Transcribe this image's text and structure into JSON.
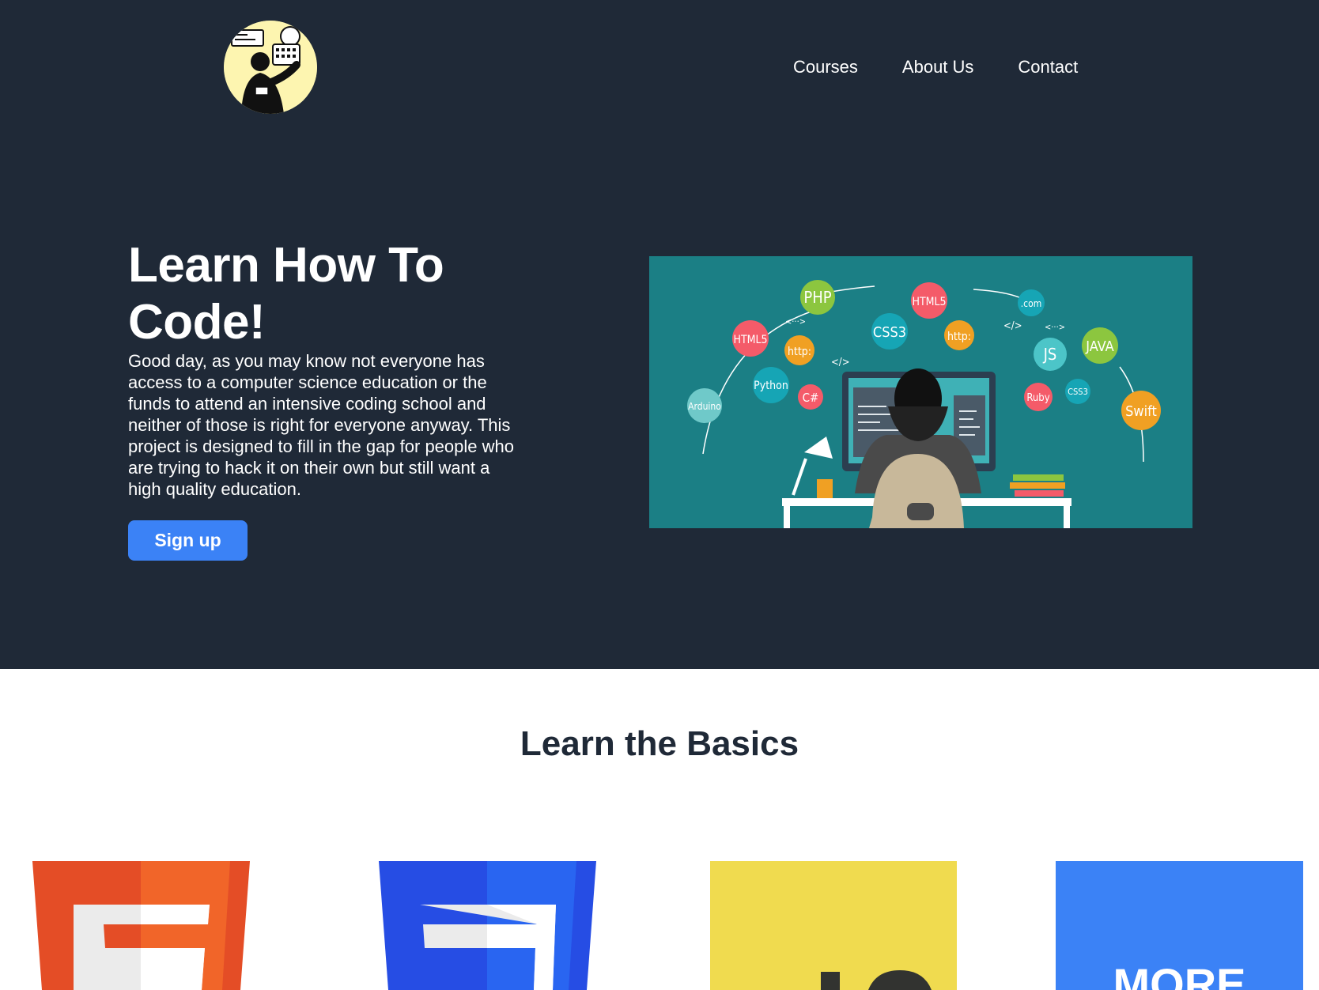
{
  "brand": {
    "logo_icon": "programmer-illustration-logo",
    "colors": {
      "hero_bg": "#1f2937",
      "accent": "#3b82f6",
      "hero_image_bg": "#1b7f85"
    }
  },
  "nav": {
    "items": [
      {
        "label": "Courses"
      },
      {
        "label": "About Us"
      },
      {
        "label": "Contact"
      }
    ]
  },
  "hero": {
    "title": "Learn How To Code!",
    "text": "Good day, as you may know not everyone has access to a computer science education or the funds to attend an intensive coding school and neither of those is right for everyone anyway. This project is designed to fill in the gap for people who are trying to hack it on their own but still want a high quality education.",
    "signup_label": "Sign up",
    "image": {
      "bubbles": [
        "PHP",
        "HTML5",
        "CSS3",
        "http:",
        ".com",
        "HTML5",
        "http:",
        "JS",
        "JAVA",
        "Python",
        "C#",
        "Ruby",
        "CSS3",
        "Swift",
        "Arduino"
      ],
      "code_tags": [
        "</>",
        "</>",
        "<···>",
        "<···>"
      ]
    }
  },
  "basics": {
    "title": "Learn the Basics",
    "cards": [
      {
        "name": "html5",
        "icon": "html5-icon"
      },
      {
        "name": "css3",
        "icon": "css3-icon"
      },
      {
        "name": "js",
        "icon": "javascript-icon"
      },
      {
        "name": "more",
        "label": "MORE"
      }
    ]
  }
}
